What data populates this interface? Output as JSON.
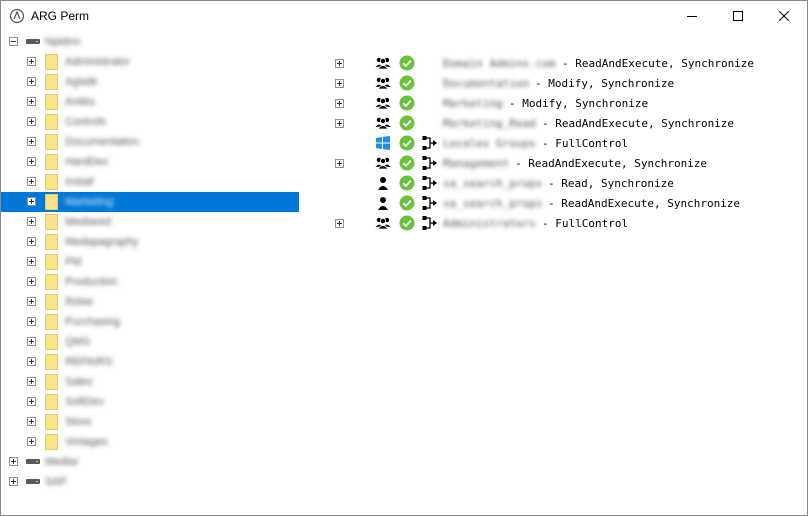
{
  "window": {
    "title": "ARG Perm",
    "icon": "arg-perm-app-icon",
    "controls": [
      "minimize-icon",
      "maximize-icon",
      "close-icon"
    ]
  },
  "tree": {
    "roots": [
      {
        "label": "Nptdnn",
        "expanded": true,
        "icon": "drive-icon",
        "children": [
          {
            "label": "Administrator",
            "selected": false
          },
          {
            "label": "Agistik",
            "selected": false
          },
          {
            "label": "Antiks",
            "selected": false
          },
          {
            "label": "Controls",
            "selected": false
          },
          {
            "label": "Documentation",
            "selected": false
          },
          {
            "label": "HardDev",
            "selected": false
          },
          {
            "label": "Install",
            "selected": false
          },
          {
            "label": "Marketing",
            "selected": true
          },
          {
            "label": "Mediared",
            "selected": false
          },
          {
            "label": "Medapagraphy",
            "selected": false
          },
          {
            "label": "PM",
            "selected": false
          },
          {
            "label": "Production",
            "selected": false
          },
          {
            "label": "Rolse",
            "selected": false
          },
          {
            "label": "Purchasing",
            "selected": false
          },
          {
            "label": "QMS",
            "selected": false
          },
          {
            "label": "REPAIRS",
            "selected": false
          },
          {
            "label": "Sales",
            "selected": false
          },
          {
            "label": "SoftDev",
            "selected": false
          },
          {
            "label": "Store",
            "selected": false
          },
          {
            "label": "Vintages",
            "selected": false
          }
        ]
      },
      {
        "label": "Mediar",
        "expanded": false,
        "icon": "drive-icon"
      },
      {
        "label": "SAP",
        "expanded": false,
        "icon": "drive-icon"
      }
    ]
  },
  "acl": {
    "entries": [
      {
        "expandable": true,
        "kind": "group-icon",
        "status": "check-icon",
        "inherited": false,
        "name": "Domain Admins.com",
        "perm": "- ReadAndExecute, Synchronize"
      },
      {
        "expandable": true,
        "kind": "group-icon",
        "status": "check-icon",
        "inherited": false,
        "name": "Documentation",
        "perm": "- Modify, Synchronize"
      },
      {
        "expandable": true,
        "kind": "group-icon",
        "status": "check-icon",
        "inherited": false,
        "name": "Marketing",
        "perm": "- Modify, Synchronize"
      },
      {
        "expandable": true,
        "kind": "group-icon",
        "status": "check-icon",
        "inherited": false,
        "name": "Marketing_Read",
        "perm": "- ReadAndExecute, Synchronize"
      },
      {
        "expandable": false,
        "kind": "windows-icon",
        "status": "check-icon",
        "inherited": true,
        "name": "Locales Groups",
        "perm": "- FullControl"
      },
      {
        "expandable": true,
        "kind": "group-icon",
        "status": "check-icon",
        "inherited": true,
        "name": "Management",
        "perm": "- ReadAndExecute, Synchronize"
      },
      {
        "expandable": false,
        "kind": "user-icon",
        "status": "check-icon",
        "inherited": true,
        "name": "sa_search_props",
        "perm": "- Read, Synchronize"
      },
      {
        "expandable": false,
        "kind": "user-icon",
        "status": "check-icon",
        "inherited": true,
        "name": "sa_search_props",
        "perm": "- ReadAndExecute, Synchronize"
      },
      {
        "expandable": true,
        "kind": "group-icon",
        "status": "check-icon",
        "inherited": true,
        "name": "Administrators",
        "perm": "- FullControl"
      }
    ]
  },
  "colors": {
    "selection": "#0078d7",
    "folder": "#fbe28d",
    "check": "#6ac33b",
    "windows": "#1e90e0"
  }
}
